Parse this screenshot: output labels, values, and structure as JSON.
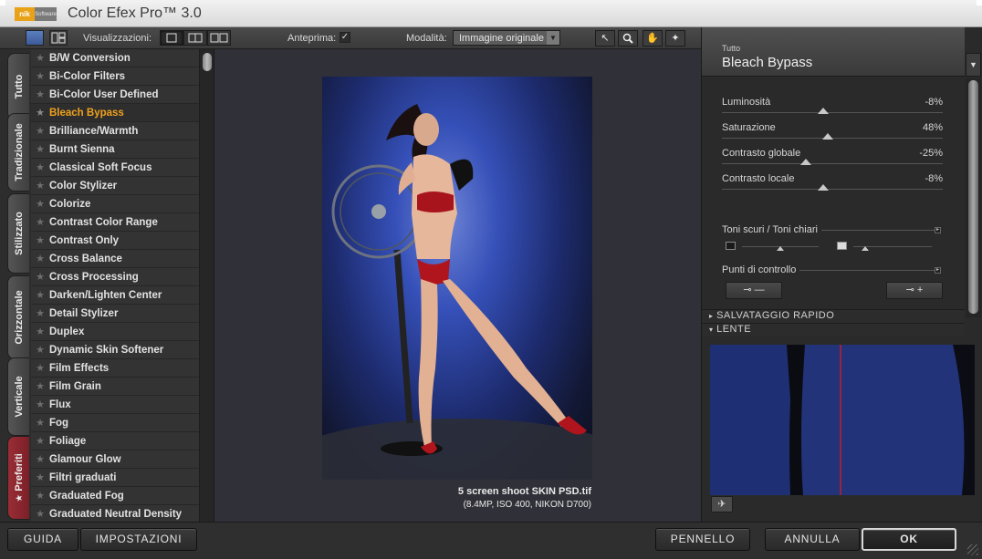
{
  "app": {
    "title": "Color Efex Pro™ 3.0",
    "logo_nik": "nik",
    "logo_software": "Software"
  },
  "toolbar": {
    "view_label": "Visualizzazioni:",
    "preview_label": "Anteprima:",
    "preview_checked": true,
    "mode_label": "Modalità:",
    "mode_value": "Immagine originale"
  },
  "tabs": [
    {
      "label": "Tutto"
    },
    {
      "label": "Tradizionale"
    },
    {
      "label": "Stilizzato"
    },
    {
      "label": "Orizzontale"
    },
    {
      "label": "Verticale"
    },
    {
      "label": "Preferiti"
    }
  ],
  "filters": {
    "selected_index": 3,
    "items": [
      "B/W Conversion",
      "Bi-Color Filters",
      "Bi-Color User Defined",
      "Bleach Bypass",
      "Brilliance/Warmth",
      "Burnt Sienna",
      "Classical Soft Focus",
      "Color Stylizer",
      "Colorize",
      "Contrast Color Range",
      "Contrast Only",
      "Cross Balance",
      "Cross Processing",
      "Darken/Lighten Center",
      "Detail Stylizer",
      "Duplex",
      "Dynamic Skin Softener",
      "Film Effects",
      "Film Grain",
      "Flux",
      "Fog",
      "Foliage",
      "Glamour Glow",
      "Filtri graduati",
      "Graduated Fog",
      "Graduated Neutral Density"
    ]
  },
  "preview": {
    "filename": "5 screen shoot SKIN PSD.tif",
    "details": "(8.4MP, ISO 400, NIKON D700)"
  },
  "panel": {
    "category": "Tutto",
    "filter_name": "Bleach Bypass",
    "sliders": [
      {
        "label": "Luminosità",
        "value": "-8%",
        "position": 0.46
      },
      {
        "label": "Saturazione",
        "value": "48%",
        "position": 0.48
      },
      {
        "label": "Contrasto globale",
        "value": "-25%",
        "position": 0.38
      },
      {
        "label": "Contrasto locale",
        "value": "-8%",
        "position": 0.46
      }
    ],
    "tones_title": "Toni scuri / Toni chiari",
    "tones_shadow_position": 0.5,
    "tones_highlight_position": 0.15,
    "control_points_title": "Punti di controllo",
    "quick_save": "SALVATAGGIO RAPIDO",
    "lens": "LENTE"
  },
  "buttons": {
    "help": "GUIDA",
    "settings": "IMPOSTAZIONI",
    "brush": "PENNELLO",
    "cancel": "ANNULLA",
    "ok": "OK"
  },
  "colors": {
    "accent_selected": "#f0a21e",
    "favorites_tab": "#8a2630",
    "lens_red_line": "#c0202a"
  }
}
